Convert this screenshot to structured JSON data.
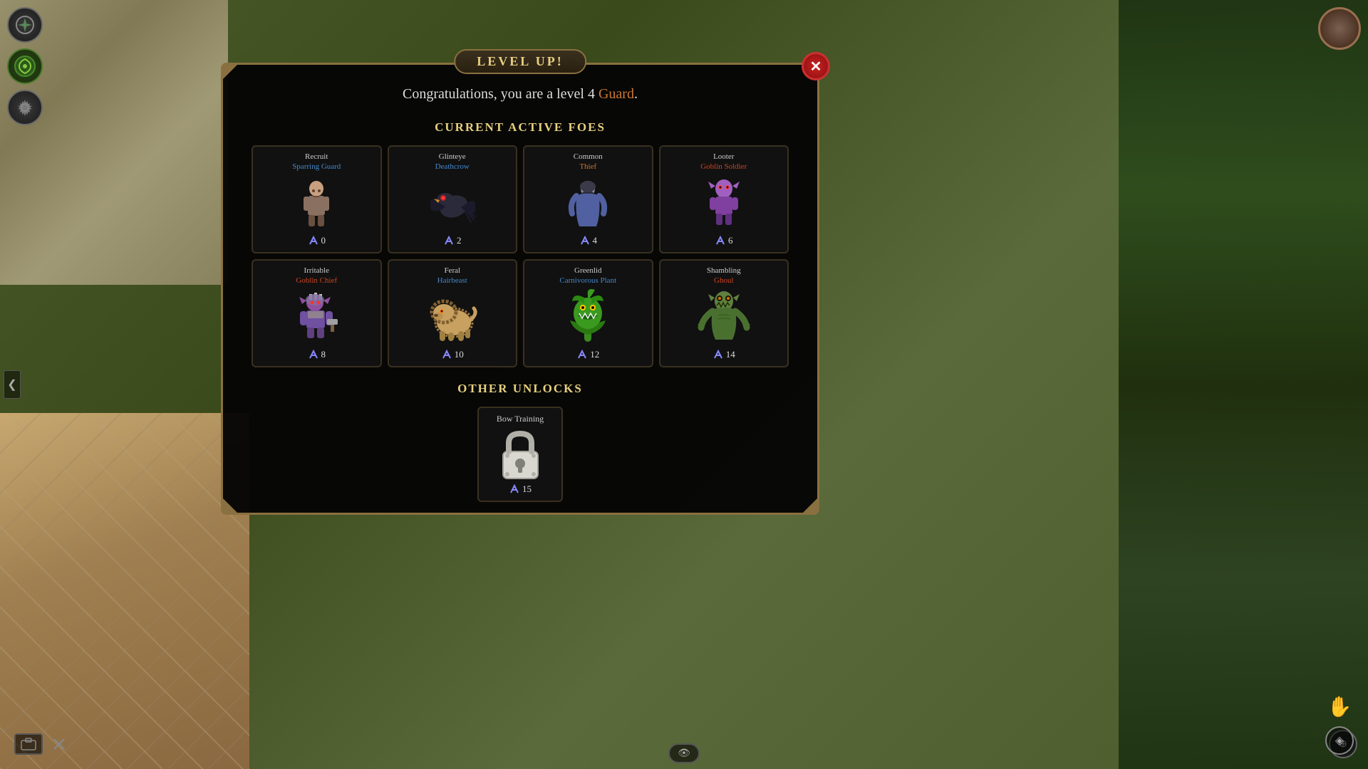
{
  "modal": {
    "title": "LEVEL UP!",
    "congratulations": "Congratulations, you are a level 4 ",
    "level_num": "4",
    "class_name": "Guard",
    "period": ".",
    "active_foes_title": "CURRENT ACTIVE FOES",
    "other_unlocks_title": "OTHER UNLOCKS",
    "close_label": "✕"
  },
  "foes": [
    {
      "name_top": "Recruit",
      "name_sub": "Sparring Guard",
      "sub_color": "blue",
      "score": "0",
      "color_type": "blue"
    },
    {
      "name_top": "Glinteye",
      "name_sub": "Deathcrow",
      "sub_color": "blue",
      "score": "2",
      "color_type": "blue"
    },
    {
      "name_top": "Common",
      "name_sub": "Thief",
      "sub_color": "orange",
      "score": "4",
      "color_type": "orange"
    },
    {
      "name_top": "Looter",
      "name_sub": "Goblin Soldier",
      "sub_color": "goblin",
      "score": "6",
      "color_type": "goblin"
    },
    {
      "name_top": "Irritable",
      "name_sub": "Goblin Chief",
      "sub_color": "goblin",
      "score": "8",
      "color_type": "goblin"
    },
    {
      "name_top": "Feral",
      "name_sub": "Hairbeast",
      "sub_color": "blue",
      "score": "10",
      "color_type": "blue"
    },
    {
      "name_top": "Greenlid",
      "name_sub": "Carnivorous Plant",
      "sub_color": "blue",
      "score": "12",
      "color_type": "blue"
    },
    {
      "name_top": "Shambling",
      "name_sub": "Ghoul",
      "sub_color": "goblin",
      "score": "14",
      "color_type": "goblin"
    }
  ],
  "unlocks": [
    {
      "name": "Bow Training",
      "score": "15"
    }
  ],
  "hud": {
    "arrow_left": "❮",
    "hand_symbol": "✋",
    "eye_symbol": "👁"
  }
}
